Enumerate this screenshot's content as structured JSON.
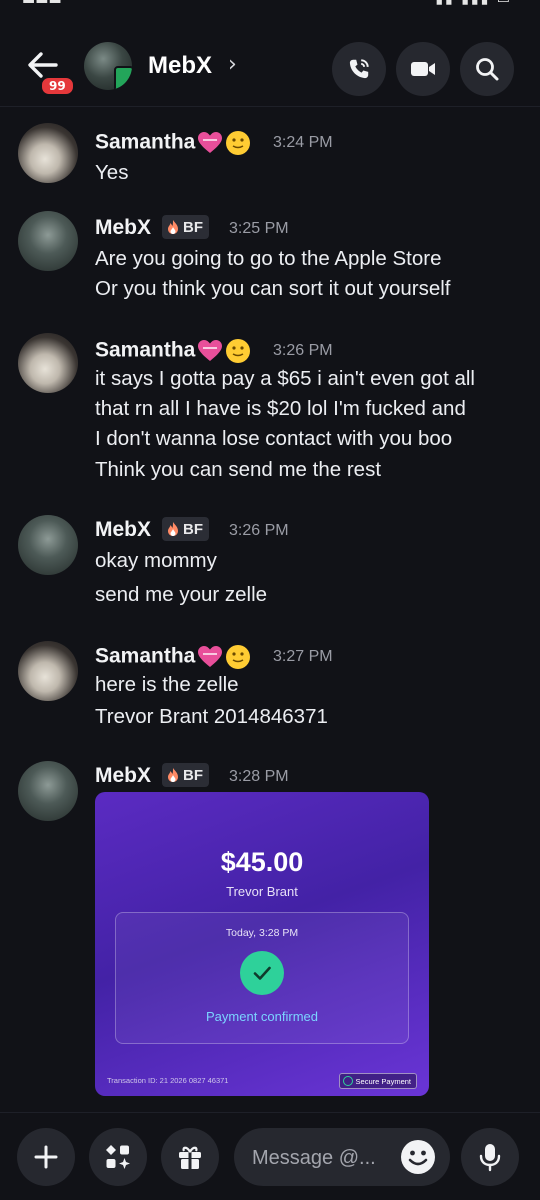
{
  "header": {
    "title": "MebX",
    "unread_badge": "99"
  },
  "messages": [
    {
      "author": "Samantha",
      "time": "3:24 PM",
      "lines": [
        "Yes"
      ]
    },
    {
      "author": "MebX",
      "tag": "BF",
      "time": "3:25 PM",
      "lines": [
        "Are you going to go to the Apple Store",
        "Or you think you can sort it out yourself"
      ]
    },
    {
      "author": "Samantha",
      "time": "3:26 PM",
      "lines": [
        "it says I gotta pay a  $65 i ain't even got all",
        "that rn all I have is $20 lol I'm fucked and",
        "I don't wanna lose contact with you boo",
        "Think you can send me the rest"
      ]
    },
    {
      "author": "MebX",
      "tag": "BF",
      "time": "3:26 PM",
      "lines": [
        "okay mommy",
        "send me your zelle"
      ]
    },
    {
      "author": "Samantha",
      "time": "3:27 PM",
      "lines": [
        "here is the zelle",
        "Trevor Brant 2014846371"
      ]
    },
    {
      "author": "MebX",
      "tag": "BF",
      "time": "3:28 PM",
      "lines": []
    }
  ],
  "receipt": {
    "amount": "$45.00",
    "payee": "Trevor Brant",
    "date": "Today, 3:28 PM",
    "status": "Payment confirmed",
    "footer": "Transaction ID: 21 2026 0827 46371",
    "secure": "Secure Payment"
  },
  "composer": {
    "placeholder": "Message @..."
  },
  "colors": {
    "background": "#111217",
    "button_bg": "#26282f",
    "badge": "#e5383b",
    "receipt_purple": "#4322a6",
    "confirm_green": "#2ed19a"
  },
  "icons": [
    "back-arrow-icon",
    "phone-icon",
    "video-icon",
    "search-icon",
    "plus-icon",
    "apps-icon",
    "gift-icon",
    "emoji-icon",
    "microphone-icon",
    "check-icon",
    "heart-icon",
    "slight-smile-icon",
    "fire-icon"
  ]
}
